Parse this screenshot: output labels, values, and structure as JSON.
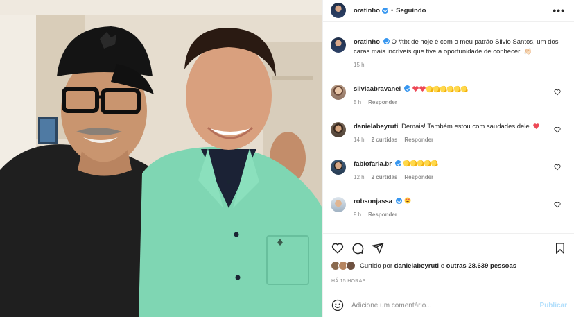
{
  "post": {
    "photo_alt": "",
    "account": "oratinho",
    "follow_state": "Seguindo",
    "more_glyph": "•••"
  },
  "caption": {
    "username": "oratinho",
    "text": "O #tbt de hoje é com o meu patrão Silvio Santos, um dos caras mais incríveis que tive a oportunidade de conhecer! 👏🏻",
    "age": "15 h"
  },
  "comments": [
    {
      "username": "silviaabravanel",
      "text": "",
      "emojis": [
        "heart",
        "heart",
        "clap",
        "clap",
        "clap",
        "clap",
        "clap",
        "clap"
      ],
      "age": "5 h",
      "likes": "",
      "reply": "Responder"
    },
    {
      "username": "danielabeyruti",
      "text": "Demais! Também estou com saudades dele.",
      "emojis": [
        "heart"
      ],
      "age": "14 h",
      "likes": "2 curtidas",
      "reply": "Responder"
    },
    {
      "username": "fabiofaria.br",
      "text": "",
      "emojis": [
        "clap",
        "clap",
        "clap",
        "clap",
        "clap"
      ],
      "age": "12 h",
      "likes": "2 curtidas",
      "reply": "Responder"
    },
    {
      "username": "robsonjassa",
      "text": "",
      "emojis": [
        "heart-eyes"
      ],
      "age": "9 h",
      "likes": "",
      "reply": "Responder"
    }
  ],
  "likes": {
    "prefix": "Curtido por",
    "user": "danielabeyruti",
    "middle": "e",
    "others": "outras 28.639 pessoas"
  },
  "timestamp": "HÁ 15 HORAS",
  "composer": {
    "placeholder": "Adicione um comentário...",
    "publish": "Publicar"
  },
  "colors": {
    "verified": "#3897f0",
    "heart": "#ed4956",
    "meta": "#8e8e8e",
    "publish_disabled": "#b2dffc"
  },
  "icons": [
    "verified-badge-icon",
    "more-options-icon",
    "heart-outline-icon",
    "comment-icon",
    "share-icon",
    "bookmark-icon",
    "emoji-icon"
  ]
}
